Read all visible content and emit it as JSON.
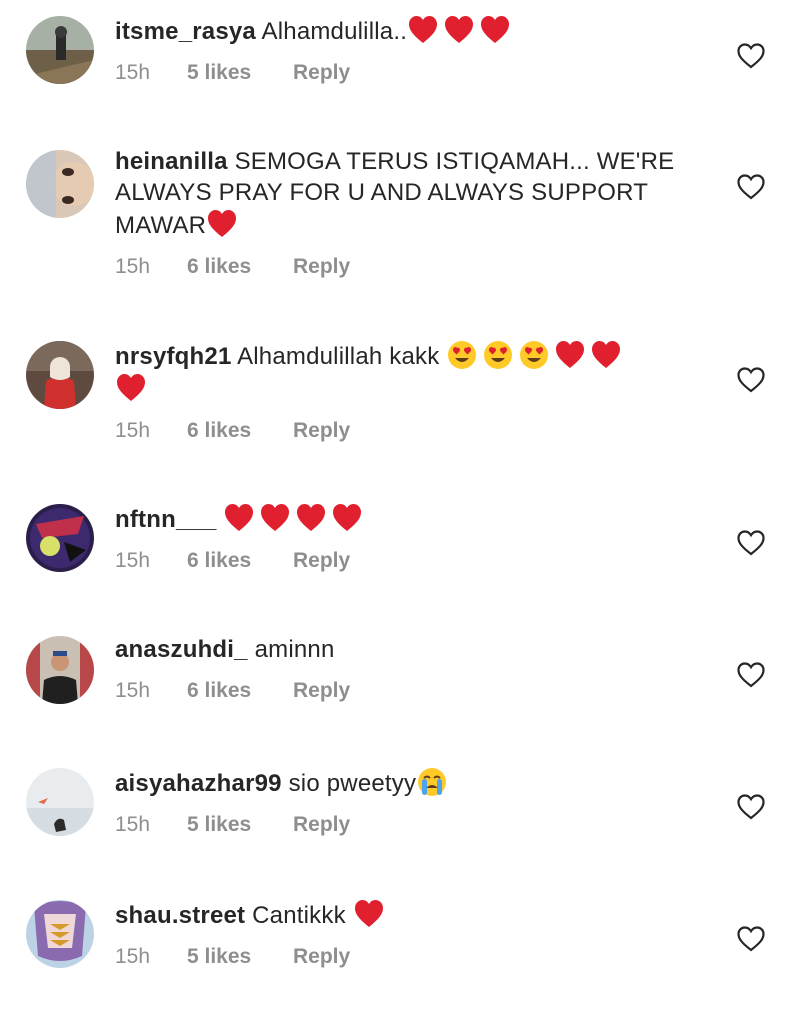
{
  "comments": [
    {
      "username": "itsme_rasya",
      "text": "Alhamdulilla..",
      "emojis": [
        "heart",
        "heart",
        "heart"
      ],
      "time": "15h",
      "likes": "5 likes",
      "reply": "Reply"
    },
    {
      "username": "heinanilla",
      "text": "SEMOGA TERUS ISTIQAMAH... WE'RE ALWAYS PRAY FOR U AND ALWAYS SUPPORT MAWAR",
      "emojis": [
        "heart"
      ],
      "time": "15h",
      "likes": "6 likes",
      "reply": "Reply"
    },
    {
      "username": "nrsyfqh21",
      "text": "Alhamdulillah kakk",
      "emojis": [
        "heart-eyes",
        "heart-eyes",
        "heart-eyes",
        "heart",
        "heart",
        "heart"
      ],
      "time": "15h",
      "likes": "6 likes",
      "reply": "Reply"
    },
    {
      "username": "nftnn___",
      "text": "",
      "emojis": [
        "heart",
        "heart",
        "heart",
        "heart"
      ],
      "time": "15h",
      "likes": "6 likes",
      "reply": "Reply"
    },
    {
      "username": "anaszuhdi_",
      "text": "aminnn",
      "emojis": [],
      "time": "15h",
      "likes": "6 likes",
      "reply": "Reply"
    },
    {
      "username": "aisyahazhar99",
      "text": "sio pweetyy",
      "emojis": [
        "crying"
      ],
      "time": "15h",
      "likes": "5 likes",
      "reply": "Reply"
    },
    {
      "username": "shau.street",
      "text": "Cantikkk",
      "emojis": [
        "heart"
      ],
      "time": "15h",
      "likes": "5 likes",
      "reply": "Reply"
    }
  ],
  "colors": {
    "heart": "#e0202e",
    "meta": "#8e8e8e",
    "text": "#262626"
  }
}
